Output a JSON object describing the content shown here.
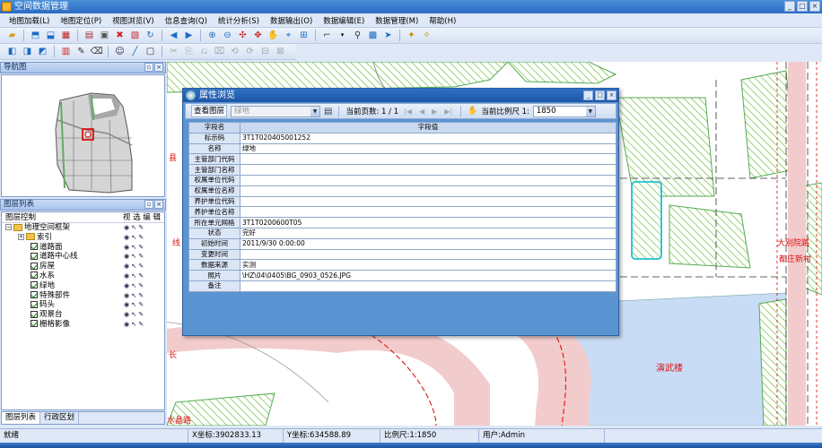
{
  "window": {
    "title": "空间数据管理",
    "buttons": [
      "_",
      "□",
      "×"
    ]
  },
  "menu": [
    "地图加载(L)",
    "地图定位(P)",
    "视图浏览(V)",
    "信息查询(Q)",
    "统计分析(S)",
    "数据输出(O)",
    "数据编辑(E)",
    "数据管理(M)",
    "帮助(H)"
  ],
  "navigator": {
    "title": "导航图"
  },
  "layers": {
    "title": "图层列表",
    "columns": {
      "name": "图层控制",
      "flags": "视 选 编 辑"
    },
    "items": [
      {
        "label": "地理空间框架",
        "level": 0,
        "type": "folder",
        "toggle": "−"
      },
      {
        "label": "索引",
        "level": 1,
        "type": "folder",
        "toggle": "+"
      },
      {
        "label": "道路面",
        "level": 2,
        "type": "layer"
      },
      {
        "label": "道路中心线",
        "level": 2,
        "type": "layer"
      },
      {
        "label": "房屋",
        "level": 2,
        "type": "layer"
      },
      {
        "label": "水系",
        "level": 2,
        "type": "layer"
      },
      {
        "label": "绿地",
        "level": 2,
        "type": "layer"
      },
      {
        "label": "特殊部件",
        "level": 2,
        "type": "layer"
      },
      {
        "label": "码头",
        "level": 2,
        "type": "layer"
      },
      {
        "label": "观景台",
        "level": 2,
        "type": "layer"
      },
      {
        "label": "栅格影像",
        "level": 2,
        "type": "layer"
      }
    ]
  },
  "bottom_tabs": [
    "图层列表",
    "行政区划"
  ],
  "dialog": {
    "title": "属性浏览",
    "view_layer_label": "查看图层",
    "layer_select": "绿地",
    "page_label": "当前页数: 1 / 1",
    "scale_label": "当前比例尺 1:",
    "scale_value": "1850",
    "header": {
      "key": "字段名",
      "value": "字段值"
    },
    "rows": [
      {
        "key": "标示码",
        "value": "3T1T020405001252"
      },
      {
        "key": "名称",
        "value": "绿地"
      },
      {
        "key": "主管部门代码",
        "value": ""
      },
      {
        "key": "主管部门名称",
        "value": ""
      },
      {
        "key": "权属单位代码",
        "value": ""
      },
      {
        "key": "权属单位名称",
        "value": ""
      },
      {
        "key": "养护单位代码",
        "value": ""
      },
      {
        "key": "养护单位名称",
        "value": ""
      },
      {
        "key": "所在单元网格",
        "value": "3T1T0200600T05"
      },
      {
        "key": "状态",
        "value": "完好"
      },
      {
        "key": "初始时间",
        "value": "2011/9/30 0:00:00"
      },
      {
        "key": "变更时间",
        "value": ""
      },
      {
        "key": "数据来源",
        "value": "实测"
      },
      {
        "key": "照片",
        "value": "\\HZ\\04\\0405\\BG_0903_0526.JPG"
      },
      {
        "key": "备注",
        "value": ""
      }
    ]
  },
  "map": {
    "labels": {
      "museum": "演武楼",
      "road_right_1": "大别院路",
      "road_right_2": "都庄新村",
      "road_bottom": "水晶路"
    },
    "colors": {
      "green": "#7ec850",
      "road_pink": "#f2cccc",
      "water_blue": "#c9dcf5",
      "label_red": "#dd1111"
    }
  },
  "status": {
    "ready": "就绪",
    "x": "X坐标:3902833.13",
    "y": "Y坐标:634588.89",
    "scale": "比例尺:1:1850",
    "user": "用户:Admin"
  }
}
